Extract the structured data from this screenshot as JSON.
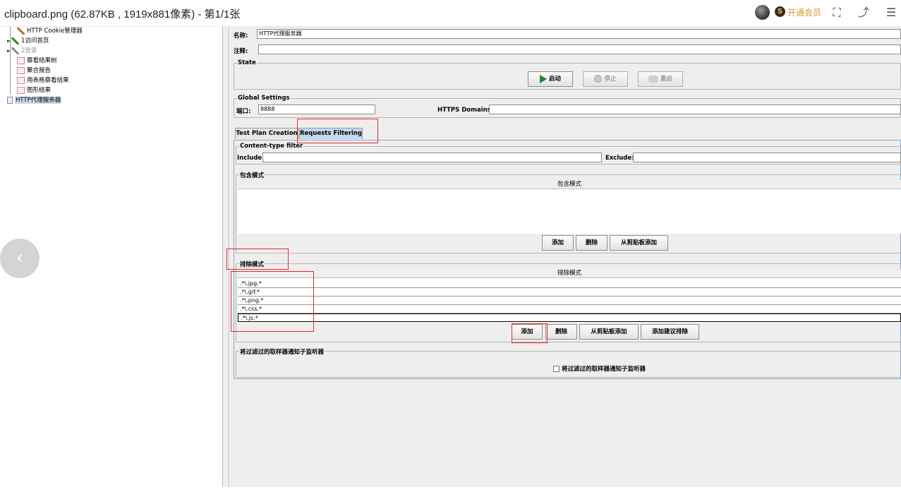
{
  "viewer": {
    "title": "clipboard.png (62.87KB , 1919x881像素) - 第1/1张",
    "vip_badge": "S",
    "vip_label": "开通会员",
    "icons": [
      "user-avatar",
      "fullscreen-icon",
      "rotate-icon",
      "menu-icon"
    ],
    "nav_prev": "‹"
  },
  "tree": {
    "items": [
      {
        "label": "HTTP Cookie管理器",
        "icon": "wrench-icon"
      },
      {
        "label": "1访问首页",
        "icon": "pen-icon"
      },
      {
        "label": "2登录",
        "icon": "pen-icon"
      },
      {
        "label": "察看结果树",
        "icon": "graph-icon"
      },
      {
        "label": "聚合报告",
        "icon": "graph-icon"
      },
      {
        "label": "用表格察看结果",
        "icon": "graph-icon"
      },
      {
        "label": "图形结果",
        "icon": "graph-icon"
      },
      {
        "label": "HTTP代理服务器",
        "icon": "proxy-icon"
      }
    ]
  },
  "config": {
    "name_label": "名称:",
    "name_value": "HTTP代理服务器",
    "comment_label": "注释:",
    "comment_value": "",
    "state": {
      "title": "State",
      "start_label": "启动",
      "stop_label": "停止",
      "restart_label": "重启"
    },
    "global": {
      "title": "Global Settings",
      "port_label": "端口:",
      "port_value": "8888",
      "https_label": "HTTPS Domains:",
      "https_value": ""
    },
    "tabs": [
      {
        "label": "Test Plan Creation",
        "active": false
      },
      {
        "label": "Requests Filtering",
        "active": true
      }
    ],
    "content_filter": {
      "title": "Content-type filter",
      "include_label": "Include:",
      "include_value": "",
      "exclude_label": "Exclude:",
      "exclude_value": ""
    },
    "include_patterns": {
      "title": "包含模式",
      "header": "包含模式",
      "rows": [],
      "add_label": "添加",
      "delete_label": "删除",
      "paste_label": "从剪贴板添加"
    },
    "exclude_patterns": {
      "title": "排除模式",
      "header": "排除模式",
      "rows": [
        ".*\\.jpg.*",
        ".*\\.gif.*",
        ".*\\.png.*",
        ".*\\.css.*",
        ".*\\.js.*"
      ],
      "add_label": "添加",
      "delete_label": "删除",
      "paste_label": "从剪贴板添加",
      "suggest_label": "添加建议排除"
    },
    "notify": {
      "title": "将过滤过的取样器通知子监听器",
      "checkbox_label": "将过滤过的取样器通知子监听器",
      "checked": false
    }
  },
  "colors": {
    "annotation_red": "#e8282a",
    "active_tab": "#c5d8ee",
    "panel_bg": "#eeeeee",
    "start_green": "#1f8a2e",
    "vip_gold": "#d99a2b"
  }
}
